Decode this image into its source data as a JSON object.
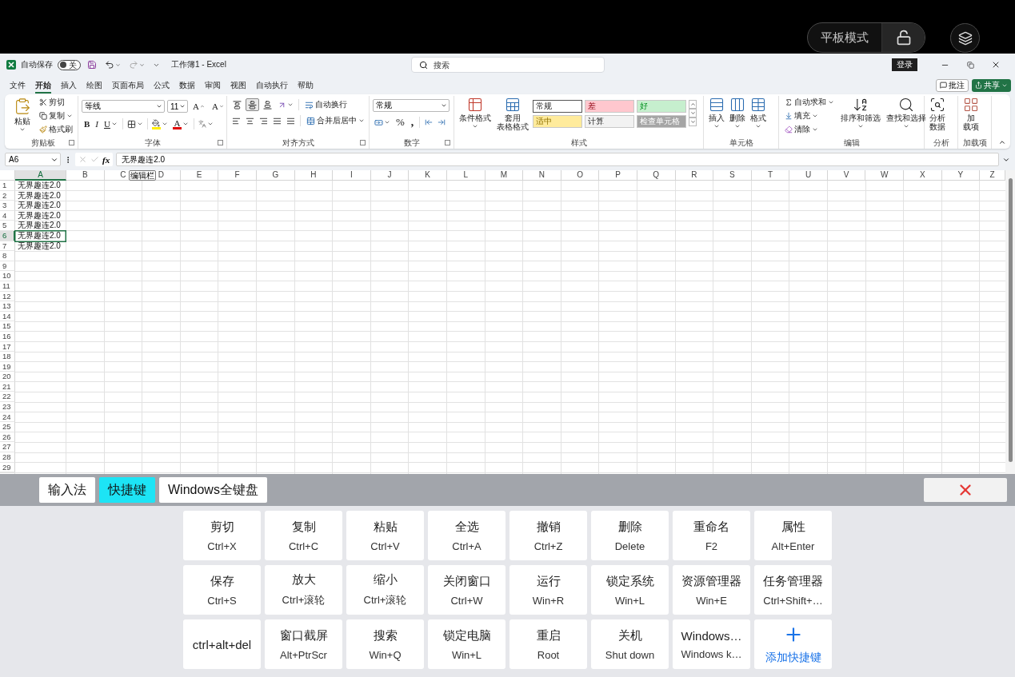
{
  "top_bar": {
    "tablet_mode": "平板模式"
  },
  "title_bar": {
    "autosave": {
      "label": "自动保存",
      "state_label": "关",
      "on": false
    },
    "document_title": "工作簿1 - Excel",
    "search": {
      "placeholder": "搜索"
    },
    "sign_in": "登录"
  },
  "menu": {
    "tabs": [
      {
        "label": "文件",
        "selected": false
      },
      {
        "label": "开始",
        "selected": true
      },
      {
        "label": "插入",
        "selected": false
      },
      {
        "label": "绘图",
        "selected": false
      },
      {
        "label": "页面布局",
        "selected": false
      },
      {
        "label": "公式",
        "selected": false
      },
      {
        "label": "数据",
        "selected": false
      },
      {
        "label": "审阅",
        "selected": false
      },
      {
        "label": "视图",
        "selected": false
      },
      {
        "label": "自动执行",
        "selected": false
      },
      {
        "label": "帮助",
        "selected": false
      }
    ],
    "comments": "批注",
    "share": "共享"
  },
  "ribbon": {
    "clipboard": {
      "title": "剪贴板",
      "paste": "粘贴",
      "cut": "剪切",
      "copy": "复制",
      "format_painter": "格式刷"
    },
    "font": {
      "title": "字体",
      "font_name": "等线",
      "font_size": "11",
      "grow_font": "A",
      "shrink_font": "A",
      "bold": "B",
      "italic": "I",
      "underline": "U",
      "font_color": "A"
    },
    "alignment": {
      "title": "对齐方式",
      "vertical_align": [
        {
          "selected": false
        },
        {
          "selected": true
        },
        {
          "selected": false
        }
      ],
      "wrap_text": "自动换行",
      "merge_center": "合并后居中"
    },
    "number": {
      "title": "数字",
      "format": "常规",
      "percent": "%",
      "comma": ","
    },
    "styles": {
      "title": "样式",
      "conditional_formatting": "条件格式",
      "format_as_table": [
        "套用",
        "表格格式"
      ],
      "cell_styles": [
        {
          "label": "常规",
          "color": "#ffffff"
        },
        {
          "label": "差",
          "color": "#ffc7ce"
        },
        {
          "label": "好",
          "color": "#c6efce"
        },
        {
          "label": "适中",
          "color": "#ffeb9c"
        },
        {
          "label": "计算",
          "color": "#f2f2f2"
        },
        {
          "label": "检查单元格",
          "color": "#a5a5a5"
        }
      ]
    },
    "cells": {
      "title": "单元格",
      "insert": "插入",
      "delete": "删除",
      "format": "格式"
    },
    "editing": {
      "title": "编辑",
      "autosum": "自动求和",
      "fill": "填充",
      "clear": "清除",
      "sort_filter": "排序和筛选",
      "find_select": "查找和选择"
    },
    "analysis": {
      "title": "分析",
      "analyze_data": [
        "分析",
        "数据"
      ]
    },
    "addins": {
      "title": "加载项",
      "addins": [
        "加",
        "载项"
      ]
    }
  },
  "formula_bar": {
    "name_box": "A6",
    "function_label": "fx",
    "formula": "无界趣连2.0",
    "tooltip": "编辑栏"
  },
  "sheet": {
    "columns": [
      {
        "label": "A",
        "selected": true
      },
      {
        "label": "B",
        "selected": false
      },
      {
        "label": "C",
        "selected": false
      },
      {
        "label": "D",
        "selected": false
      },
      {
        "label": "E",
        "selected": false
      },
      {
        "label": "F",
        "selected": false
      },
      {
        "label": "G",
        "selected": false
      },
      {
        "label": "H",
        "selected": false
      },
      {
        "label": "I",
        "selected": false
      },
      {
        "label": "J",
        "selected": false
      },
      {
        "label": "K",
        "selected": false
      },
      {
        "label": "L",
        "selected": false
      },
      {
        "label": "M",
        "selected": false
      },
      {
        "label": "N",
        "selected": false
      },
      {
        "label": "O",
        "selected": false
      },
      {
        "label": "P",
        "selected": false
      },
      {
        "label": "Q",
        "selected": false
      },
      {
        "label": "R",
        "selected": false
      },
      {
        "label": "S",
        "selected": false
      },
      {
        "label": "T",
        "selected": false
      },
      {
        "label": "U",
        "selected": false
      },
      {
        "label": "V",
        "selected": false
      },
      {
        "label": "W",
        "selected": false
      },
      {
        "label": "X",
        "selected": false
      },
      {
        "label": "Y",
        "selected": false
      },
      {
        "label": "Z",
        "selected": false
      }
    ],
    "rows": [
      {
        "number": "1",
        "selected": false,
        "cells": [
          "无界趣连2.0"
        ]
      },
      {
        "number": "2",
        "selected": false,
        "cells": [
          "无界趣连2.0"
        ]
      },
      {
        "number": "3",
        "selected": false,
        "cells": [
          "无界趣连2.0"
        ]
      },
      {
        "number": "4",
        "selected": false,
        "cells": [
          "无界趣连2.0"
        ]
      },
      {
        "number": "5",
        "selected": false,
        "cells": [
          "无界趣连2.0"
        ]
      },
      {
        "number": "6",
        "selected": true,
        "cells": [
          "无界趣连2.0"
        ]
      },
      {
        "number": "7",
        "selected": false,
        "cells": [
          "无界趣连2.0"
        ]
      },
      {
        "number": "8",
        "selected": false
      },
      {
        "number": "9",
        "selected": false
      },
      {
        "number": "10",
        "selected": false
      },
      {
        "number": "11",
        "selected": false
      },
      {
        "number": "12",
        "selected": false
      },
      {
        "number": "13",
        "selected": false
      },
      {
        "number": "14",
        "selected": false
      },
      {
        "number": "15",
        "selected": false
      },
      {
        "number": "16",
        "selected": false
      },
      {
        "number": "17",
        "selected": false
      },
      {
        "number": "18",
        "selected": false
      },
      {
        "number": "19",
        "selected": false
      },
      {
        "number": "20",
        "selected": false
      },
      {
        "number": "21",
        "selected": false
      },
      {
        "number": "22",
        "selected": false
      },
      {
        "number": "23",
        "selected": false
      },
      {
        "number": "24",
        "selected": false
      },
      {
        "number": "25",
        "selected": false
      },
      {
        "number": "26",
        "selected": false
      },
      {
        "number": "27",
        "selected": false
      },
      {
        "number": "28",
        "selected": false
      },
      {
        "number": "29",
        "selected": false
      }
    ]
  },
  "keyboard": {
    "tabs": [
      {
        "label": "输入法",
        "selected": false
      },
      {
        "label": "快捷键",
        "selected": true
      },
      {
        "label": "Windows全键盘",
        "selected": false
      }
    ],
    "shortcuts": [
      {
        "kind": "shortcut",
        "name": "剪切",
        "keys": "Ctrl+X"
      },
      {
        "kind": "shortcut",
        "name": "复制",
        "keys": "Ctrl+C"
      },
      {
        "kind": "shortcut",
        "name": "粘贴",
        "keys": "Ctrl+V"
      },
      {
        "kind": "shortcut",
        "name": "全选",
        "keys": "Ctrl+A"
      },
      {
        "kind": "shortcut",
        "name": "撤销",
        "keys": "Ctrl+Z"
      },
      {
        "kind": "shortcut",
        "name": "删除",
        "keys": "Delete"
      },
      {
        "kind": "shortcut",
        "name": "重命名",
        "keys": "F2"
      },
      {
        "kind": "shortcut",
        "name": "属性",
        "keys": "Alt+Enter"
      },
      {
        "kind": "shortcut",
        "name": "保存",
        "keys": "Ctrl+S"
      },
      {
        "kind": "shortcut",
        "name": "放大",
        "keys": "Ctrl+滚轮"
      },
      {
        "kind": "shortcut",
        "name": "缩小",
        "keys": "Ctrl+滚轮"
      },
      {
        "kind": "shortcut",
        "name": "关闭窗口",
        "keys": "Ctrl+W"
      },
      {
        "kind": "shortcut",
        "name": "运行",
        "keys": "Win+R"
      },
      {
        "kind": "shortcut",
        "name": "锁定系统",
        "keys": "Win+L"
      },
      {
        "kind": "shortcut",
        "name": "资源管理器",
        "keys": "Win+E"
      },
      {
        "kind": "shortcut",
        "name": "任务管理器",
        "keys": "Ctrl+Shift+…"
      },
      {
        "kind": "single",
        "name": "ctrl+alt+del"
      },
      {
        "kind": "shortcut",
        "name": "窗口截屏",
        "keys": "Alt+PtrScr"
      },
      {
        "kind": "shortcut",
        "name": "搜索",
        "keys": "Win+Q"
      },
      {
        "kind": "shortcut",
        "name": "锁定电脑",
        "keys": "Win+L"
      },
      {
        "kind": "shortcut",
        "name": "重启",
        "keys": "Root"
      },
      {
        "kind": "shortcut",
        "name": "关机",
        "keys": "Shut down"
      },
      {
        "kind": "shortcut",
        "name": "Windows…",
        "keys": "Windows k…"
      },
      {
        "kind": "add",
        "name": "添加快捷键"
      }
    ]
  }
}
